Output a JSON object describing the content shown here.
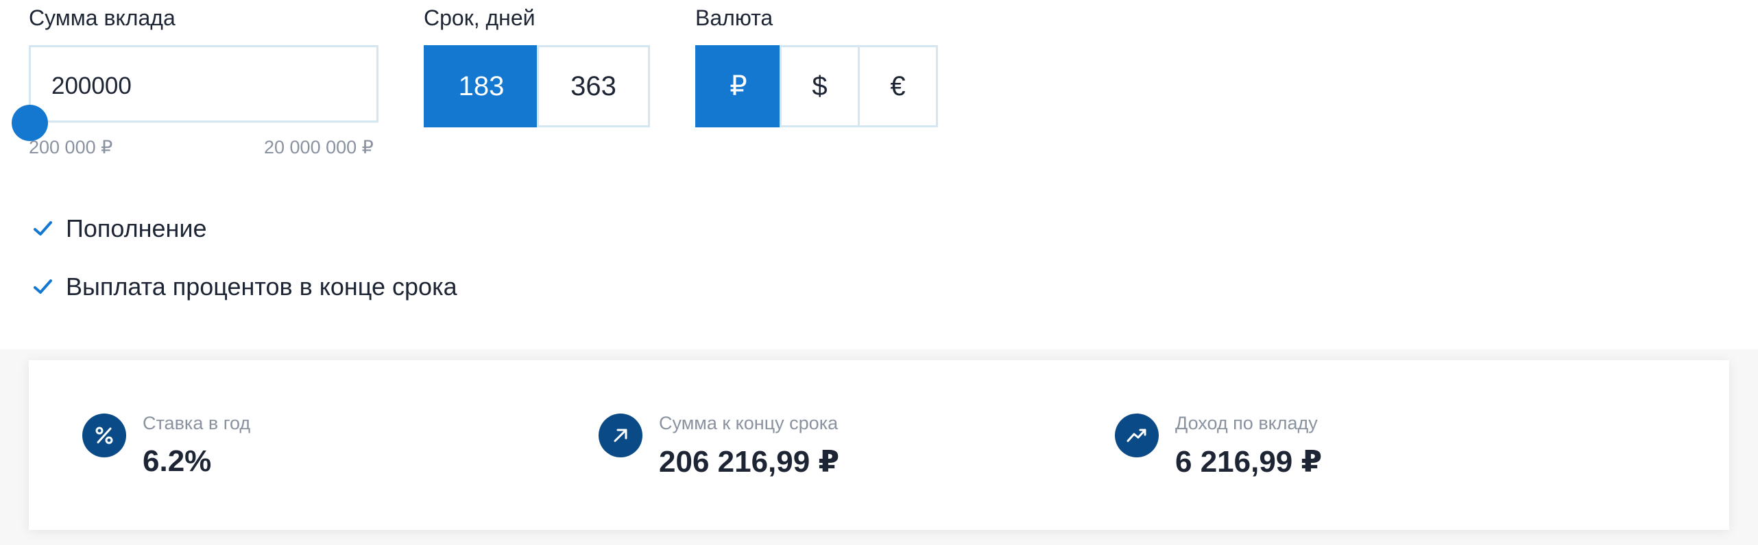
{
  "amount": {
    "label": "Сумма вклада",
    "value": "200000",
    "min_label": "200 000 ₽",
    "max_label": "20 000 000 ₽",
    "slider_fraction": 0.0
  },
  "term": {
    "label": "Срок, дней",
    "options": [
      "183",
      "363"
    ],
    "selected": "183"
  },
  "currency": {
    "label": "Валюта",
    "options": [
      "₽",
      "$",
      "€"
    ],
    "selected": "₽"
  },
  "options": [
    {
      "label": "Пополнение",
      "checked": true,
      "icon": "check-icon"
    },
    {
      "label": "Выплата процентов в конце срока",
      "checked": true,
      "icon": "check-icon"
    }
  ],
  "results": [
    {
      "label": "Ставка в год",
      "value": "6.2%",
      "icon": "percent-icon"
    },
    {
      "label": "Сумма к концу срока",
      "value": "206 216,99 ₽",
      "icon": "arrow-up-right-icon"
    },
    {
      "label": "Доход по вкладу",
      "value": "6 216,99 ₽",
      "icon": "trend-up-icon"
    }
  ],
  "colors": {
    "accent": "#1478d0",
    "icon_bg": "#0a4a86",
    "border": "#d5e6f3",
    "muted_text": "#8a92a0",
    "text": "#1d2433"
  }
}
